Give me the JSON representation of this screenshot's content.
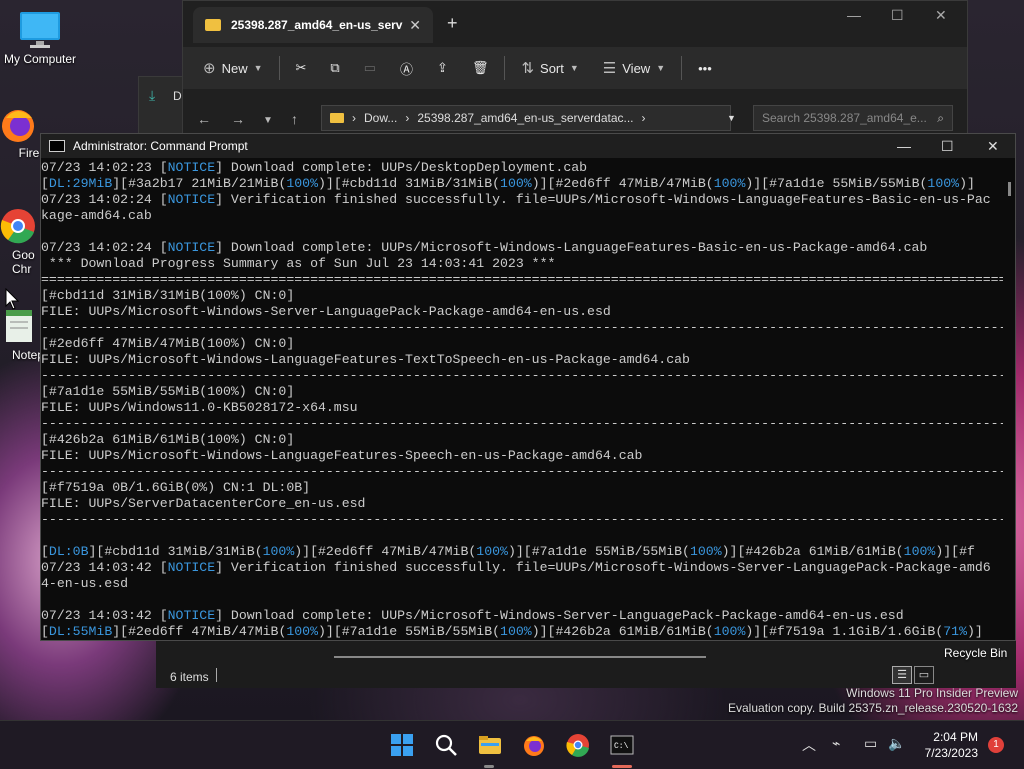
{
  "desktop": {
    "icons": [
      {
        "label": "My Computer"
      },
      {
        "label": "Fire"
      },
      {
        "label": "Goo Chr"
      },
      {
        "label": "Notep"
      }
    ],
    "recycle_bin": "Recycle Bin",
    "watermark": {
      "line1": "Windows 11 Pro Insider Preview",
      "line2": "Evaluation copy. Build 25375.zn_release.230520-1632"
    }
  },
  "explorer": {
    "tab_title": "25398.287_amd64_en-us_serv",
    "toolbar": {
      "new": "New",
      "sort": "Sort",
      "view": "View",
      "more": "•••"
    },
    "address": {
      "seg1": "Dow...",
      "seg2": "25398.287_amd64_en-us_serverdatac..."
    },
    "search_placeholder": "Search 25398.287_amd64_e...",
    "status": "6 items",
    "behind_label": "D"
  },
  "cmd": {
    "title": "Administrator: Command Prompt",
    "lines": [
      [
        {
          "t": "07/23 14:02:23 [",
          "c": ""
        },
        {
          "t": "NOTICE",
          "c": "blue"
        },
        {
          "t": "] Download complete: UUPs/DesktopDeployment.cab",
          "c": ""
        }
      ],
      [
        {
          "t": "[",
          "c": ""
        },
        {
          "t": "DL:",
          "c": "blue"
        },
        {
          "t": "29MiB",
          "c": "blue"
        },
        {
          "t": "][#3a2b17 21MiB/21MiB(",
          "c": ""
        },
        {
          "t": "100%",
          "c": "blue"
        },
        {
          "t": ")][#cbd11d 31MiB/31MiB(",
          "c": ""
        },
        {
          "t": "100%",
          "c": "blue"
        },
        {
          "t": ")][#2ed6ff 47MiB/47MiB(",
          "c": ""
        },
        {
          "t": "100%",
          "c": "blue"
        },
        {
          "t": ")][#7a1d1e 55MiB/55MiB(",
          "c": ""
        },
        {
          "t": "100%",
          "c": "blue"
        },
        {
          "t": ")]",
          "c": ""
        }
      ],
      [
        {
          "t": "07/23 14:02:24 [",
          "c": ""
        },
        {
          "t": "NOTICE",
          "c": "blue"
        },
        {
          "t": "] Verification finished successfully. file=UUPs/Microsoft-Windows-LanguageFeatures-Basic-en-us-Pac",
          "c": ""
        }
      ],
      [
        {
          "t": "kage-amd64.cab",
          "c": ""
        }
      ],
      [
        {
          "t": "",
          "c": ""
        }
      ],
      [
        {
          "t": "07/23 14:02:24 [",
          "c": ""
        },
        {
          "t": "NOTICE",
          "c": "blue"
        },
        {
          "t": "] Download complete: UUPs/Microsoft-Windows-LanguageFeatures-Basic-en-us-Package-amd64.cab",
          "c": ""
        }
      ],
      [
        {
          "t": " *** Download Progress Summary as of Sun Jul 23 14:03:41 2023 ***",
          "c": ""
        }
      ],
      [
        {
          "t": "==============================================================================================================================",
          "c": ""
        }
      ],
      [
        {
          "t": "[#cbd11d 31MiB/31MiB(100%) CN:0]",
          "c": ""
        }
      ],
      [
        {
          "t": "FILE: UUPs/Microsoft-Windows-Server-LanguagePack-Package-amd64-en-us.esd",
          "c": ""
        }
      ],
      [
        {
          "t": "------------------------------------------------------------------------------------------------------------------------------",
          "c": ""
        }
      ],
      [
        {
          "t": "[#2ed6ff 47MiB/47MiB(100%) CN:0]",
          "c": ""
        }
      ],
      [
        {
          "t": "FILE: UUPs/Microsoft-Windows-LanguageFeatures-TextToSpeech-en-us-Package-amd64.cab",
          "c": ""
        }
      ],
      [
        {
          "t": "------------------------------------------------------------------------------------------------------------------------------",
          "c": ""
        }
      ],
      [
        {
          "t": "[#7a1d1e 55MiB/55MiB(100%) CN:0]",
          "c": ""
        }
      ],
      [
        {
          "t": "FILE: UUPs/Windows11.0-KB5028172-x64.msu",
          "c": ""
        }
      ],
      [
        {
          "t": "------------------------------------------------------------------------------------------------------------------------------",
          "c": ""
        }
      ],
      [
        {
          "t": "[#426b2a 61MiB/61MiB(100%) CN:0]",
          "c": ""
        }
      ],
      [
        {
          "t": "FILE: UUPs/Microsoft-Windows-LanguageFeatures-Speech-en-us-Package-amd64.cab",
          "c": ""
        }
      ],
      [
        {
          "t": "------------------------------------------------------------------------------------------------------------------------------",
          "c": ""
        }
      ],
      [
        {
          "t": "[#f7519a 0B/1.6GiB(0%) CN:1 DL:0B]",
          "c": ""
        }
      ],
      [
        {
          "t": "FILE: UUPs/ServerDatacenterCore_en-us.esd",
          "c": ""
        }
      ],
      [
        {
          "t": "------------------------------------------------------------------------------------------------------------------------------",
          "c": ""
        }
      ],
      [
        {
          "t": "",
          "c": ""
        }
      ],
      [
        {
          "t": "[",
          "c": ""
        },
        {
          "t": "DL:",
          "c": "blue"
        },
        {
          "t": "0B",
          "c": "blue"
        },
        {
          "t": "][#cbd11d 31MiB/31MiB(",
          "c": ""
        },
        {
          "t": "100%",
          "c": "blue"
        },
        {
          "t": ")][#2ed6ff 47MiB/47MiB(",
          "c": ""
        },
        {
          "t": "100%",
          "c": "blue"
        },
        {
          "t": ")][#7a1d1e 55MiB/55MiB(",
          "c": ""
        },
        {
          "t": "100%",
          "c": "blue"
        },
        {
          "t": ")][#426b2a 61MiB/61MiB(",
          "c": ""
        },
        {
          "t": "100%",
          "c": "blue"
        },
        {
          "t": ")][#f",
          "c": ""
        }
      ],
      [
        {
          "t": "07/23 14:03:42 [",
          "c": ""
        },
        {
          "t": "NOTICE",
          "c": "blue"
        },
        {
          "t": "] Verification finished successfully. file=UUPs/Microsoft-Windows-Server-LanguagePack-Package-amd6",
          "c": ""
        }
      ],
      [
        {
          "t": "4-en-us.esd",
          "c": ""
        }
      ],
      [
        {
          "t": "",
          "c": ""
        }
      ],
      [
        {
          "t": "07/23 14:03:42 [",
          "c": ""
        },
        {
          "t": "NOTICE",
          "c": "blue"
        },
        {
          "t": "] Download complete: UUPs/Microsoft-Windows-Server-LanguagePack-Package-amd64-en-us.esd",
          "c": ""
        }
      ],
      [
        {
          "t": "[",
          "c": ""
        },
        {
          "t": "DL:",
          "c": "blue"
        },
        {
          "t": "55MiB",
          "c": "blue"
        },
        {
          "t": "][#2ed6ff 47MiB/47MiB(",
          "c": ""
        },
        {
          "t": "100%",
          "c": "blue"
        },
        {
          "t": ")][#7a1d1e 55MiB/55MiB(",
          "c": ""
        },
        {
          "t": "100%",
          "c": "blue"
        },
        {
          "t": ")][#426b2a 61MiB/61MiB(",
          "c": ""
        },
        {
          "t": "100%",
          "c": "blue"
        },
        {
          "t": ")][#f7519a 1.1GiB/1.6GiB(",
          "c": ""
        },
        {
          "t": "71%",
          "c": "blue"
        },
        {
          "t": ")]",
          "c": ""
        }
      ]
    ]
  },
  "taskbar": {
    "time": "2:04 PM",
    "date": "7/23/2023",
    "notifications": "1"
  }
}
